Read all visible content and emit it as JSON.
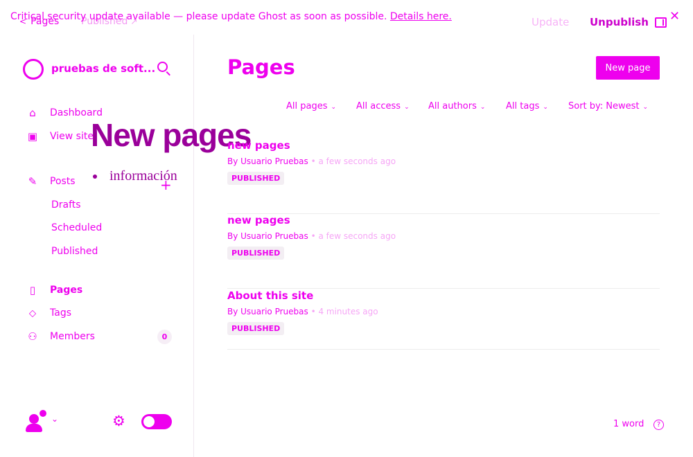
{
  "banner": {
    "text": "Critical security update available — please update Ghost as soon as possible.",
    "link": "Details here.",
    "close_icon": "close-icon"
  },
  "editor": {
    "back_label": "Pages",
    "status": "Published",
    "update_label": "Update",
    "unpublish_label": "Unpublish"
  },
  "sidebar": {
    "site_title": "pruebas de soft...",
    "nav": {
      "dashboard": "Dashboard",
      "view_site": "View site",
      "posts": "Posts",
      "drafts": "Drafts",
      "scheduled": "Scheduled",
      "published": "Published",
      "pages": "Pages",
      "tags": "Tags",
      "members": "Members",
      "members_count": "0"
    }
  },
  "overlay": {
    "heading": "New pages",
    "bullet": "información"
  },
  "main": {
    "title": "Pages",
    "new_button": "New page",
    "filters": {
      "pages": "All pages",
      "access": "All access",
      "authors": "All authors",
      "tags": "All tags",
      "sort": "Sort by: Newest"
    },
    "rows": [
      {
        "title": "new pages",
        "by": "By Usuario Pruebas",
        "time": " • a few seconds ago",
        "badge": "PUBLISHED"
      },
      {
        "title": "new pages",
        "by": "By Usuario Pruebas",
        "time": " • a few seconds ago",
        "badge": "PUBLISHED"
      },
      {
        "title": "About this site",
        "by": "By Usuario Pruebas",
        "time": " • 4 minutes ago",
        "badge": "PUBLISHED"
      }
    ]
  },
  "footer": {
    "word_count": "1 word",
    "help": "?"
  },
  "colors": {
    "accent": "#ee00ee",
    "overlay_text": "#9a009a"
  }
}
